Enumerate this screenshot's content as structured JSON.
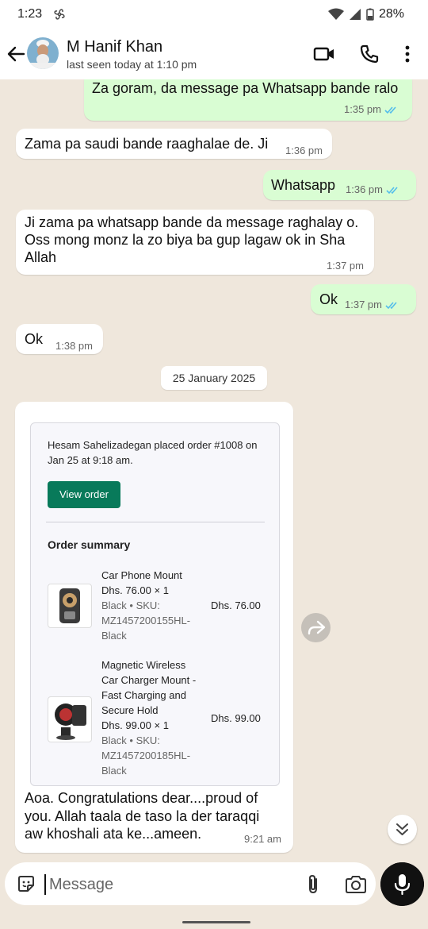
{
  "status_bar": {
    "time": "1:23",
    "battery": "28%"
  },
  "header": {
    "contact_name": "M Hanif Khan",
    "last_seen": "last seen today at 1:10 pm"
  },
  "messages": [
    {
      "direction": "out",
      "text": "Za goram, da message pa Whatsapp bande ralo",
      "time": "1:35 pm",
      "status": "read"
    },
    {
      "direction": "in",
      "text": "Zama pa saudi bande raaghalae de. Ji",
      "time": "1:36 pm"
    },
    {
      "direction": "out",
      "text": "Whatsapp",
      "time": "1:36 pm",
      "status": "read"
    },
    {
      "direction": "in",
      "text": "Ji zama pa whatsapp bande da message raghalay o. Oss mong monz la zo biya ba gup lagaw ok in Sha Allah",
      "time": "1:37 pm"
    },
    {
      "direction": "out",
      "text": "Ok",
      "time": "1:37 pm",
      "status": "read"
    },
    {
      "direction": "in",
      "text": "Ok",
      "time": "1:38 pm"
    }
  ],
  "date_separator": "25 January 2025",
  "order_card": {
    "text": "Hesam Sahelizadegan placed order #1008 on Jan 25 at 9:18 am.",
    "button_label": "View order",
    "summary_title": "Order summary",
    "items": [
      {
        "name": "Car Phone Mount",
        "qty_price": "Dhs. 76.00 × 1",
        "variant": "Black • SKU: MZ1457200155HL-Black",
        "price": "Dhs. 76.00"
      },
      {
        "name": "Magnetic Wireless Car Charger Mount - Fast Charging and Secure Hold",
        "qty_price": "Dhs. 99.00 × 1",
        "variant": "Black • SKU: MZ1457200185HL-Black",
        "price": "Dhs. 99.00"
      }
    ],
    "message": "Aoa. Congratulations dear....proud of you. Allah taala de taso la der taraqqi aw khoshali ata ke...ameen.",
    "time": "9:21 am"
  },
  "composer": {
    "placeholder": "Message"
  },
  "colors": {
    "outgoing_bubble": "#d9fdd3",
    "incoming_bubble": "#ffffff",
    "read_ticks": "#53bdeb",
    "view_order_button": "#087a5a",
    "chat_background": "#efe7dc"
  }
}
